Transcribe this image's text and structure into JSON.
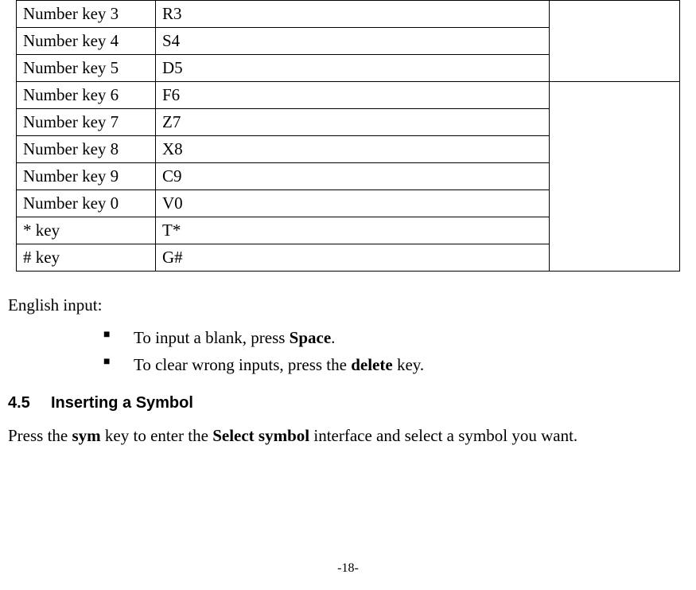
{
  "table": {
    "rows": [
      {
        "key": "Number key 3",
        "val": "R3"
      },
      {
        "key": "Number key 4",
        "val": "S4"
      },
      {
        "key": "Number key 5",
        "val": "D5"
      },
      {
        "key": "Number key 6",
        "val": "F6"
      },
      {
        "key": "Number key 7",
        "val": "Z7"
      },
      {
        "key": "Number key 8",
        "val": "X8"
      },
      {
        "key": "Number key 9",
        "val": "C9"
      },
      {
        "key": "Number key 0",
        "val": "V0"
      },
      {
        "key": "* key",
        "val": "T*"
      },
      {
        "key": "# key",
        "val": "G#"
      }
    ]
  },
  "english_input_label": "English input:",
  "bullets": {
    "b1_pre": "To input a blank, press ",
    "b1_bold": "Space",
    "b1_post": ".",
    "b2_pre": "To clear wrong inputs, press the ",
    "b2_bold": "delete",
    "b2_post": " key."
  },
  "section": {
    "num": "4.5",
    "title": "Inserting a Symbol"
  },
  "body": {
    "p1_pre": "Press the ",
    "p1_b1": "sym",
    "p1_mid": " key to enter the ",
    "p1_b2": "Select symbol",
    "p1_post": " interface and select a symbol you want."
  },
  "page_number": "-18-"
}
